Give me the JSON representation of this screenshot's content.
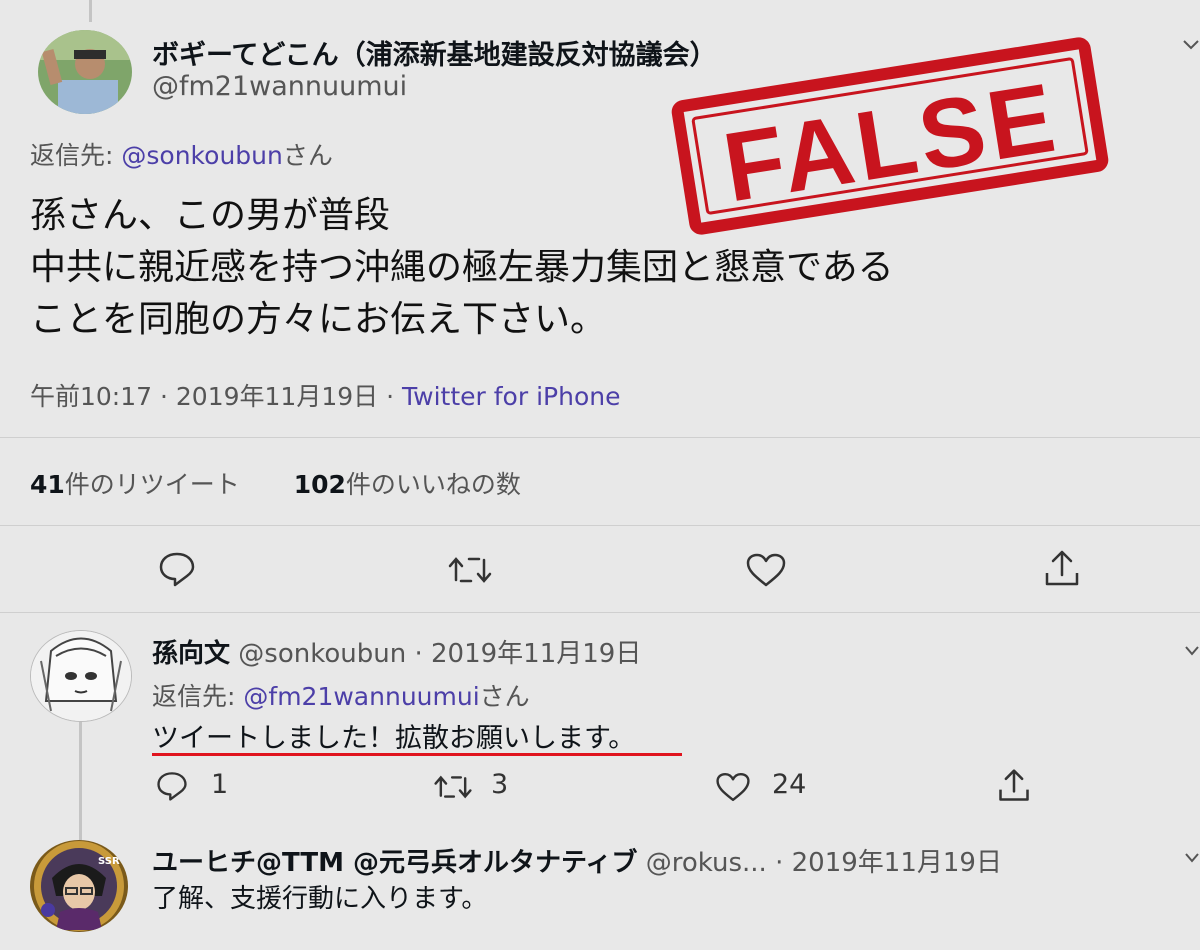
{
  "main_tweet": {
    "display_name": "ボギーてどこん（浦添新基地建設反対協議会）",
    "handle": "@fm21wannuumui",
    "reply_prefix": "返信先:",
    "reply_to": "@sonkoubun",
    "reply_suffix": "さん",
    "text_line1": "孫さん、この男が普段",
    "text_line2": "中共に親近感を持つ沖縄の極左暴力集団と懇意である",
    "text_line3": "ことを同胞の方々にお伝え下さい。",
    "time": "午前10:17",
    "sep1": "·",
    "date": "2019年11月19日",
    "sep2": "·",
    "source": "Twitter for iPhone",
    "retweet_count": "41",
    "retweet_label": "件のリツイート",
    "like_count": "102",
    "like_label": "件のいいねの数"
  },
  "stamp": {
    "text": "FALSE",
    "color": "#c8141e"
  },
  "reply1": {
    "display_name": "孫向文",
    "handle": "@sonkoubun",
    "sep": "·",
    "date": "2019年11月19日",
    "reply_prefix": "返信先:",
    "reply_to": "@fm21wannuumui",
    "reply_suffix": "さん",
    "text": "ツイートしました！拡散お願いします。",
    "reply_count": "1",
    "retweet_count": "3",
    "like_count": "24",
    "underline_color": "#e0141e"
  },
  "reply2": {
    "display_name": "ユーヒチ@TTM @元弓兵オルタナティブ",
    "handle": "@rokus...",
    "sep": "·",
    "date": "2019年11月19日",
    "text": "了解、支援行動に入ります。"
  },
  "colors": {
    "link": "#4c3fa8",
    "background": "#e8e8e8"
  }
}
